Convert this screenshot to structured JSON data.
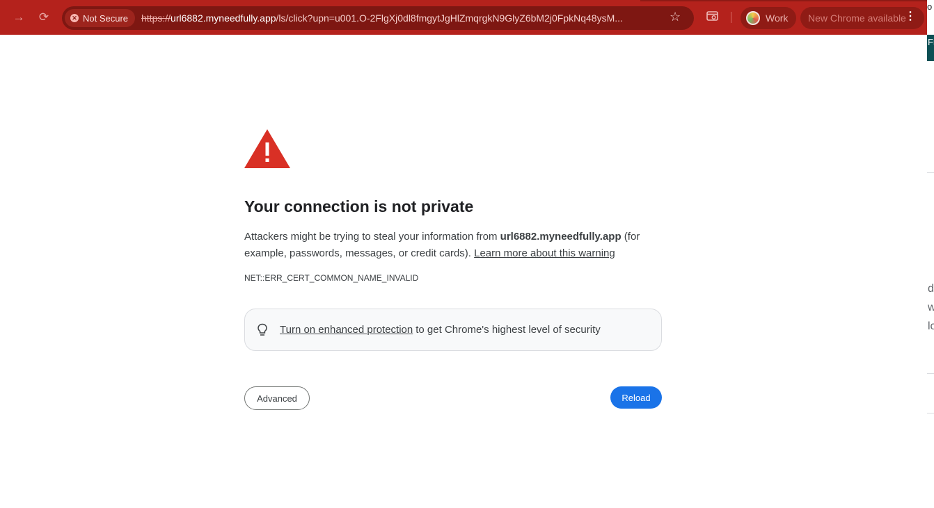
{
  "browser": {
    "security_chip_label": "Not Secure",
    "url": {
      "scheme": "https://",
      "host": "url6882.myneedfully.app",
      "path": "/ls/click?upn=u001.O-2FlgXj0dl8fmgytJgHlZmqrgkN9GlyZ6bM2j0FpkNq48ysM..."
    },
    "profile_label": "Work",
    "update_label": "New Chrome available",
    "toolbar_color": "#b4221c"
  },
  "side_window": {
    "top_text": "o",
    "banner_text": "Fre",
    "fragments": [
      "de",
      "w",
      "lo"
    ]
  },
  "interstitial": {
    "heading": "Your connection is not private",
    "explanation_before": "Attackers might be trying to steal your information from ",
    "explanation_host": "url6882.myneedfully.app",
    "explanation_after": " (for example, passwords, messages, or credit cards). ",
    "learn_more_link": "Learn more about this warning",
    "error_code": "NET::ERR_CERT_COMMON_NAME_INVALID",
    "enhanced_link": "Turn on enhanced protection",
    "enhanced_text": "to get Chrome's highest level of security",
    "advanced_button": "Advanced",
    "reload_button": "Reload",
    "warning_color": "#d93025",
    "accent_color": "#1a73e8"
  }
}
